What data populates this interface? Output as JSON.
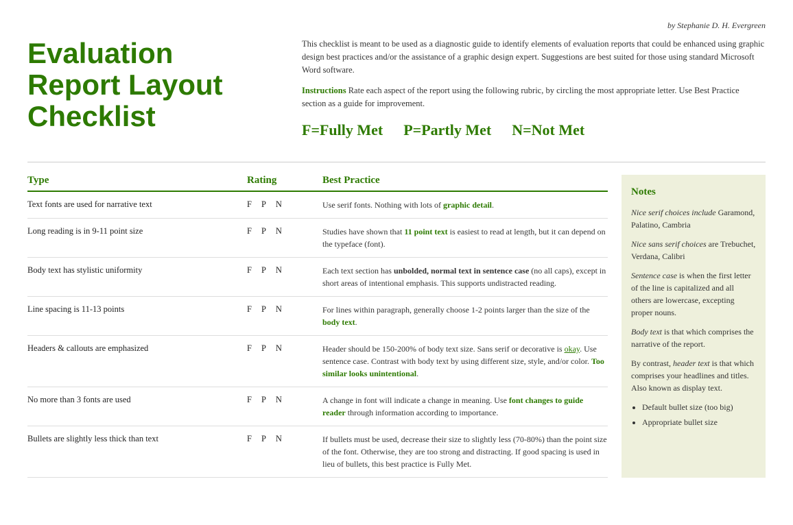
{
  "byline": "by Stephanie D. H. Evergreen",
  "title": {
    "line1": "Evaluation",
    "line2": "Report Layout",
    "line3": "Checklist"
  },
  "intro": {
    "description": "This checklist is meant to be used as a diagnostic guide to identify elements of evaluation reports that could be enhanced using graphic design best practices and/or the assistance of a graphic design expert. Suggestions are best suited for those using standard Microsoft Word software.",
    "instructions_label": "Instructions",
    "instructions_text": " Rate each aspect of the report using the following rubric, by circling the most appropriate letter. Use Best Practice section as a guide for improvement.",
    "rating_f": "F=Fully Met",
    "rating_p": "P=Partly Met",
    "rating_n": "N=Not Met"
  },
  "columns": {
    "type": "Type",
    "rating": "Rating",
    "best_practice": "Best Practice"
  },
  "rows": [
    {
      "type": "Text fonts are used for narrative text",
      "best_practice": "Use serif fonts. Nothing with lots of graphic detail."
    },
    {
      "type": "Long reading is in 9-11 point size",
      "best_practice": "Studies have shown that 11 point text is easiest to read at length, but it can depend on the typeface (font)."
    },
    {
      "type": "Body text has stylistic uniformity",
      "best_practice": "Each text section has unbolded, normal text in sentence case (no all caps), except in short areas of intentional emphasis. This supports undistracted reading."
    },
    {
      "type": "Line spacing is 11-13 points",
      "best_practice": "For lines within paragraph, generally choose 1-2 points larger than the size of the body text."
    },
    {
      "type": "Headers & callouts are emphasized",
      "best_practice": "Header should be 150-200% of body text size. Sans serif or decorative is okay. Use sentence case. Contrast with body text by using different size, style, and/or color. Too similar looks unintentional."
    },
    {
      "type": "No more than 3 fonts are used",
      "best_practice": "A change in font will indicate a change in meaning. Use font changes to guide reader through information according to importance."
    },
    {
      "type": "Bullets are slightly less thick than text",
      "best_practice": "If bullets must be used, decrease their size to slightly less (70-80%) than the point size of the font. Otherwise, they are too strong and distracting. If good spacing is used in lieu of bullets, this best practice is Fully Met."
    }
  ],
  "notes": {
    "title": "Notes",
    "para1_italic": "Nice serif choices include",
    "para1_rest": " Garamond, Palatino, Cambria",
    "para2_italic": "Nice sans serif choices",
    "para2_rest": " are Trebuchet, Verdana, Calibri",
    "para3_italic": "Sentence case",
    "para3_rest": " is when the first letter of the line is capitalized and all others are lowercase, excepting proper nouns.",
    "para4_italic": "Body text",
    "para4_rest": " is that which comprises the narrative of the report.",
    "para5_text": "By contrast, ",
    "para5_italic": "header text",
    "para5_rest": " is that which comprises your headlines and titles. Also known as display text.",
    "bullets": [
      "Default bullet size (too big)",
      "Appropriate bullet size"
    ]
  }
}
